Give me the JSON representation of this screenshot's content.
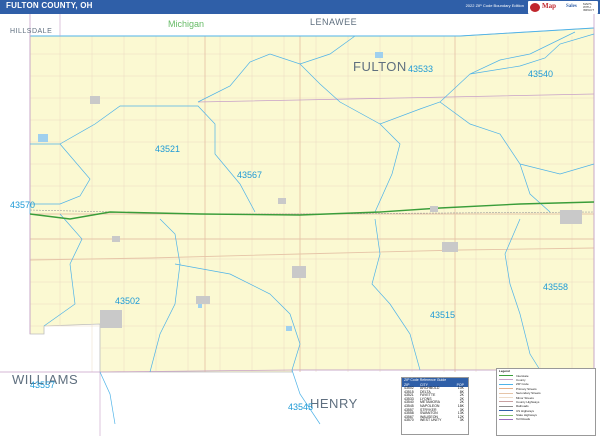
{
  "header": {
    "title": "FULTON COUNTY, OH",
    "edition": "2022 ZIP Code Boundary Edition",
    "logo_text_1": "Map",
    "logo_text_2": "Sales",
    "logo_small": "MAPS WITH IMPACT"
  },
  "map": {
    "colors": {
      "land": "#fbf9d2",
      "outside": "#ffffff",
      "zip_boundary": "#4fb3e8",
      "county_boundary": "#c7a0c8",
      "highway": "#3a9d3a",
      "roads": "#e6c5a8",
      "water": "#9fd0ee",
      "towns": "#bdbdbd"
    },
    "labels": {
      "state_michigan": "Michigan",
      "county_hillsdale": "HILLSDALE",
      "county_lenawee": "LENAWEE",
      "county_fulton": "FULTON",
      "county_williams": "WILLIAMS",
      "county_henry": "HENRY"
    },
    "zips": [
      "43533",
      "43540",
      "43521",
      "43567",
      "43570",
      "43558",
      "43502",
      "43515",
      "43557",
      "43545"
    ]
  },
  "zip_table": {
    "title": "ZIP Code Reference Guide",
    "columns": [
      "ZIP",
      "CITY",
      "POP"
    ],
    "rows": [
      [
        "43502",
        "ARCHBOLD",
        "10K"
      ],
      [
        "43515",
        "DELTA",
        "8K"
      ],
      [
        "43521",
        "FAYETTE",
        "2K"
      ],
      [
        "43533",
        "LYONS",
        "2K"
      ],
      [
        "43540",
        "METAMORA",
        "2K"
      ],
      [
        "43545",
        "NAPOLEON",
        "18K"
      ],
      [
        "43557",
        "STRYKER",
        "3K"
      ],
      [
        "43558",
        "SWANTON",
        "13K"
      ],
      [
        "43567",
        "WAUSEON",
        "12K"
      ],
      [
        "43570",
        "WEST UNITY",
        "3K"
      ]
    ]
  },
  "legend": {
    "title": "Legend",
    "items": [
      {
        "label": "Interstate",
        "color": "#3a9d3a"
      },
      {
        "label": "County",
        "color": "#c7a0c8"
      },
      {
        "label": "ZIP Code",
        "color": "#4fb3e8"
      },
      {
        "label": "Primary Streets",
        "color": "#e6b08a"
      },
      {
        "label": "Secondary Streets",
        "color": "#e6c5a8"
      },
      {
        "label": "Minor Streets",
        "color": "#eedcc8"
      },
      {
        "label": "County Highways",
        "color": "#c9a0a0"
      },
      {
        "label": "Railroads",
        "color": "#8c8c8c"
      },
      {
        "label": "US Highways",
        "color": "#2f5fa8"
      },
      {
        "label": "State Highways",
        "color": "#7bb86b"
      },
      {
        "label": "Toll Roads",
        "color": "#9b6bbd"
      }
    ]
  }
}
